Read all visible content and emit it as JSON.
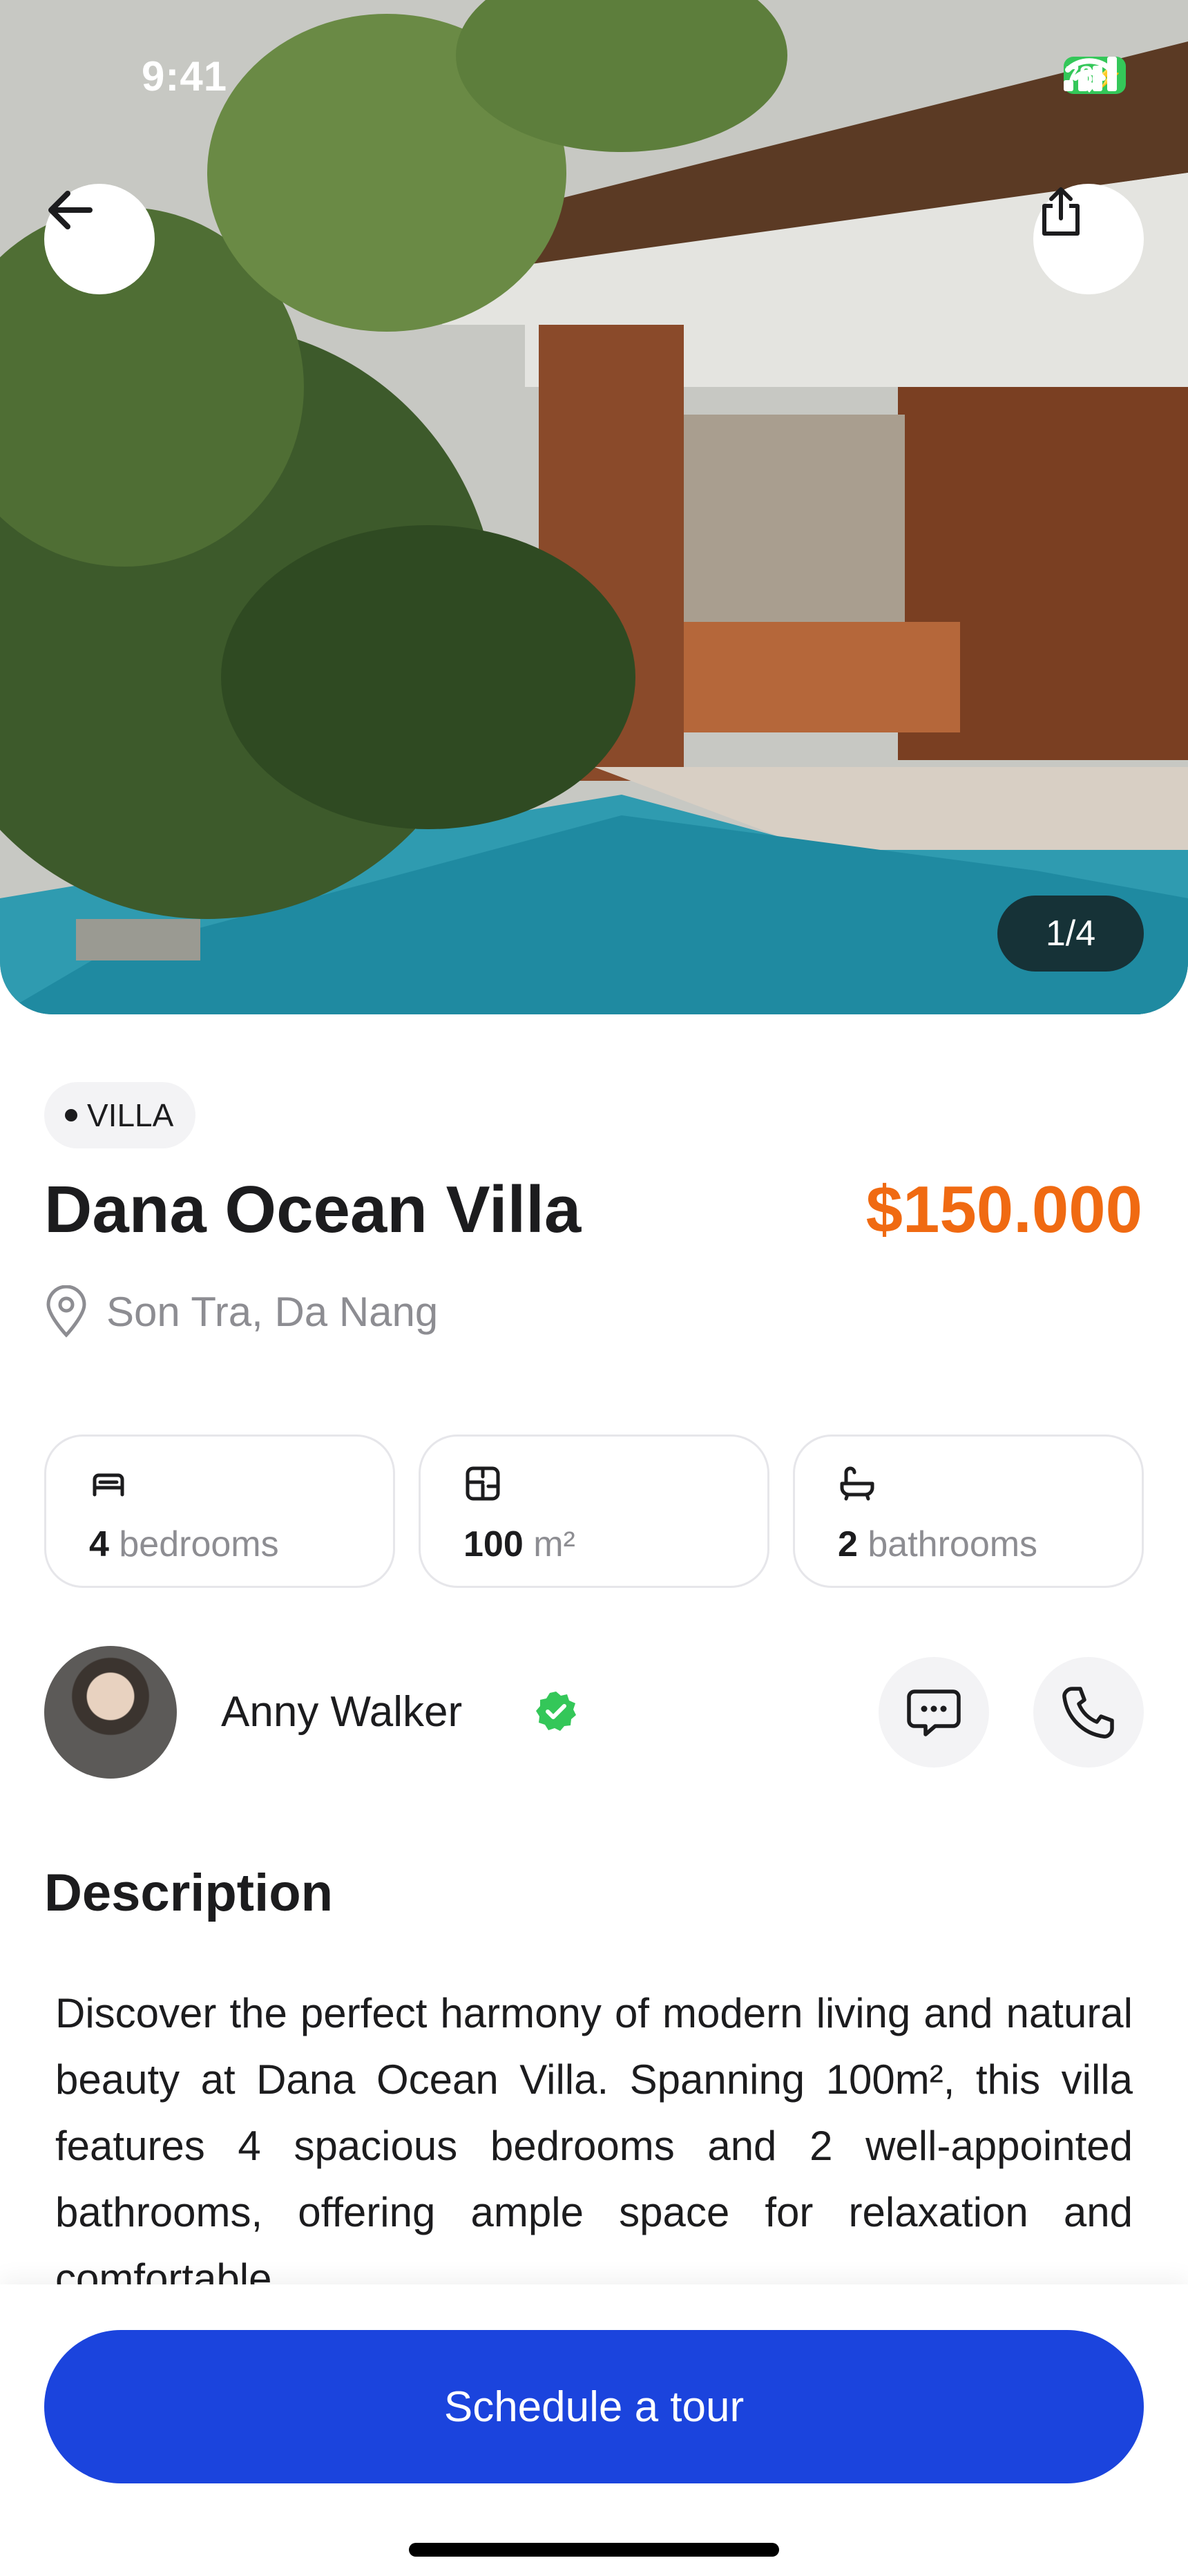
{
  "status_bar": {
    "time": "9:41",
    "battery": "78"
  },
  "gallery": {
    "counter": "1/4"
  },
  "listing": {
    "category": "VILLA",
    "title": "Dana Ocean Villa",
    "price": "$150.000",
    "location": "Son Tra, Da Nang"
  },
  "features": [
    {
      "icon": "bed-icon",
      "value": "4",
      "unit": "bedrooms"
    },
    {
      "icon": "floor-plan-icon",
      "value": "100",
      "unit": "m²"
    },
    {
      "icon": "bathtub-icon",
      "value": "2",
      "unit": "bathrooms"
    }
  ],
  "agent": {
    "name": "Anny Walker",
    "verified": true
  },
  "description": {
    "heading": "Description",
    "body": "Discover the perfect harmony of modern living and natural beauty at Dana Ocean Villa. Spanning 100m², this villa features 4 spacious bedrooms and 2 well-appointed bathrooms, offering ample space for relaxation and comfortable"
  },
  "cta": {
    "label": "Schedule a tour"
  },
  "colors": {
    "accent": "#1b44dd",
    "price": "#f06a12",
    "verified": "#34c759"
  }
}
